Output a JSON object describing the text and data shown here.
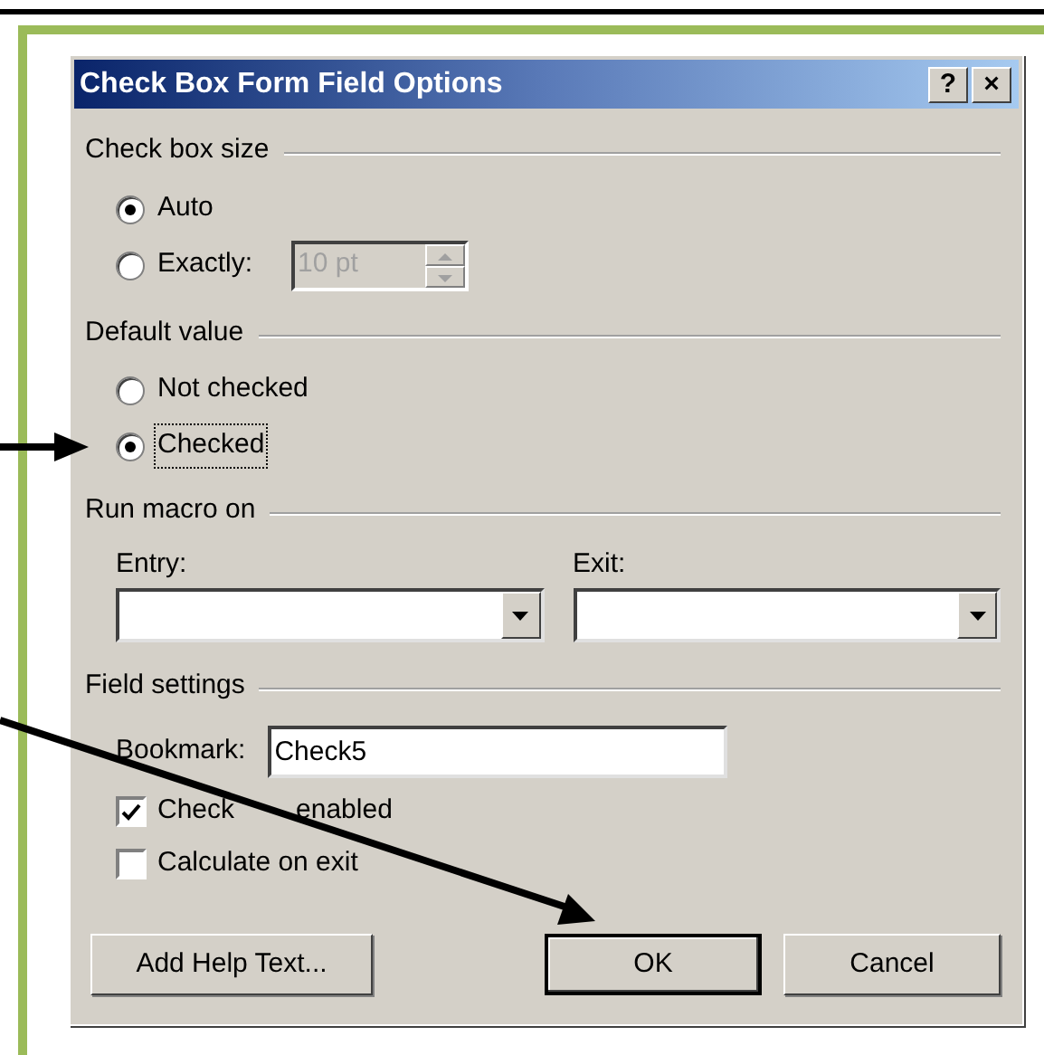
{
  "dialog": {
    "title": "Check Box Form Field Options",
    "title_buttons": [
      "?",
      "×"
    ],
    "check_box_size": {
      "label": "Check box size",
      "options": [
        {
          "label": "Auto",
          "selected": true,
          "focused": false
        },
        {
          "label": "Exactly:",
          "selected": false,
          "focused": false
        }
      ],
      "size_field": {
        "value": "10 pt",
        "disabled": true
      }
    },
    "default_value": {
      "label": "Default value",
      "options": [
        {
          "label": "Not checked",
          "selected": false,
          "focused": false
        },
        {
          "label": "Checked",
          "selected": true,
          "focused": true
        }
      ]
    },
    "run_macro_on": {
      "label": "Run macro on",
      "entry": {
        "label": "Entry:"
      },
      "exit": {
        "label": "Exit:"
      }
    },
    "field_settings": {
      "label": "Field settings",
      "bookmark": {
        "label": "Bookmark:",
        "value": "Check5"
      },
      "checkboxes": [
        {
          "label_parts": [
            "Check",
            "enabled"
          ],
          "checked": true
        },
        {
          "label_parts": [
            "Calculate on exit"
          ],
          "checked": false
        }
      ]
    },
    "buttons": [
      {
        "label": "Add Help Text...",
        "default": false
      },
      {
        "label": "OK",
        "default": true
      },
      {
        "label": "Cancel",
        "default": false
      }
    ]
  }
}
